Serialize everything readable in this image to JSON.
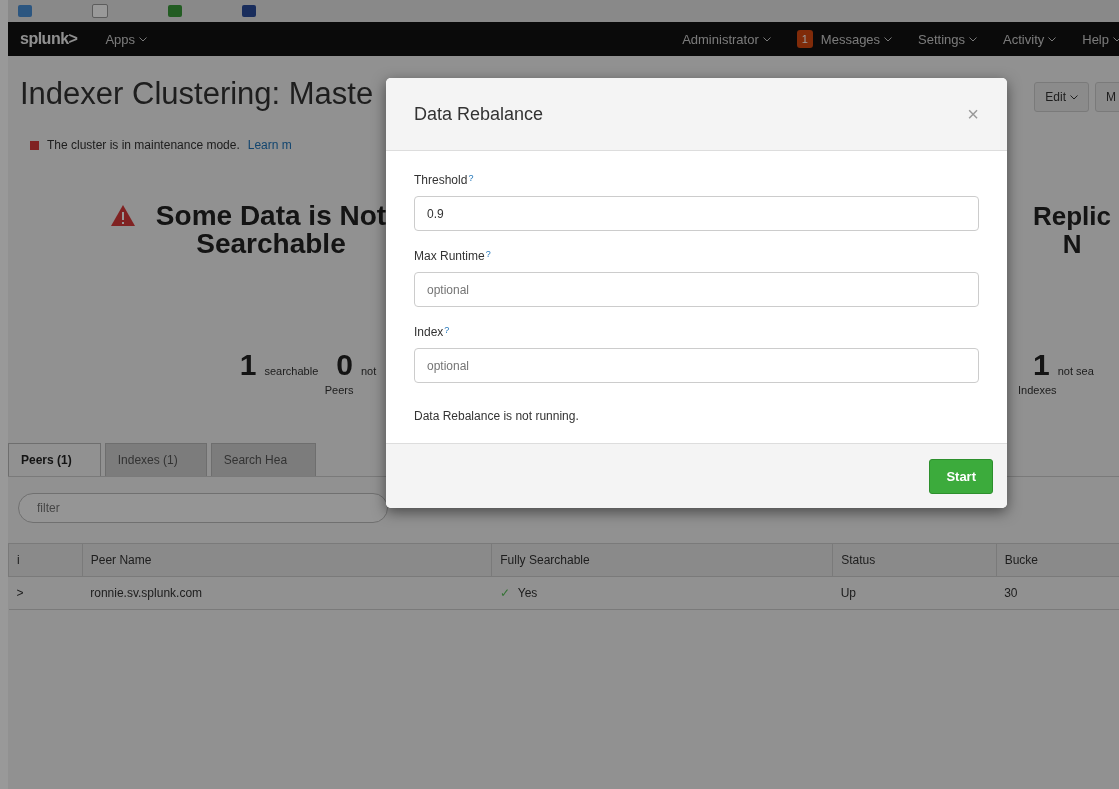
{
  "nav": {
    "logo": "splunk>",
    "apps": "Apps",
    "items": [
      {
        "label": "Administrator"
      },
      {
        "label": "Messages",
        "badge": "1"
      },
      {
        "label": "Settings"
      },
      {
        "label": "Activity"
      },
      {
        "label": "Help"
      }
    ]
  },
  "page": {
    "title": "Indexer Clustering: Maste",
    "actions": [
      "Edit",
      "M"
    ],
    "notice": {
      "text": "The cluster is in maintenance mode.",
      "link": "Learn m"
    }
  },
  "panels": [
    {
      "heading": [
        "Some Data is Not",
        "Searchable"
      ],
      "warning": true,
      "stats": [
        {
          "number": "1",
          "label": "searchable"
        },
        {
          "number": "0",
          "label": "not"
        }
      ],
      "caption": "Peers"
    },
    {
      "heading": [
        "Replic",
        "N"
      ],
      "warning": false,
      "stats": [
        {
          "number": "1",
          "label": "not sea"
        }
      ],
      "caption": "Indexes"
    }
  ],
  "tabs": [
    {
      "label": "Peers (1)",
      "selected": true
    },
    {
      "label": "Indexes (1)",
      "selected": false
    },
    {
      "label": "Search Hea",
      "selected": false
    }
  ],
  "filter": {
    "placeholder": "filter"
  },
  "table": {
    "columns": [
      "i",
      "Peer Name",
      "Fully Searchable",
      "Status",
      "Bucke"
    ],
    "rows": [
      {
        "expand": ">",
        "name": "ronnie.sv.splunk.com",
        "check": "✓",
        "searchable": "Yes",
        "status": "Up",
        "buckets": "30"
      }
    ]
  },
  "modal": {
    "title": "Data Rebalance",
    "close": "×",
    "fields": [
      {
        "label": "Threshold",
        "help": "?",
        "value": "0.9"
      },
      {
        "label": "Max Runtime",
        "help": "?",
        "placeholder": "optional"
      },
      {
        "label": "Index",
        "help": "?",
        "placeholder": "optional"
      }
    ],
    "status": "Data Rebalance is not running.",
    "button": "Start"
  }
}
